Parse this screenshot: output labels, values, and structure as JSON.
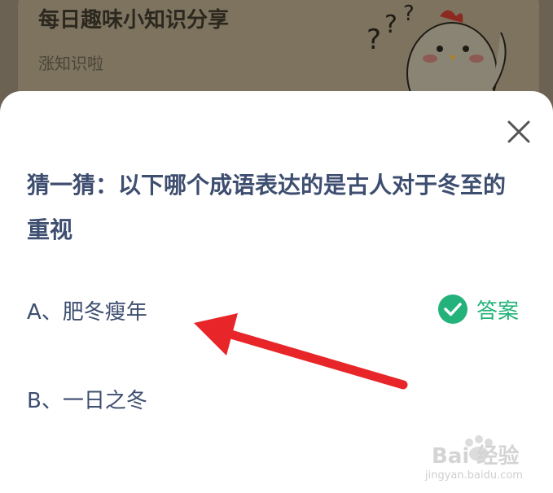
{
  "background_card": {
    "title": "每日趣味小知识分享",
    "subtitle": "涨知识啦"
  },
  "dialog": {
    "question": "猜一猜：以下哪个成语表达的是古人对于冬至的重视",
    "options": [
      {
        "label": "A、肥冬瘦年",
        "is_answer": true
      },
      {
        "label": "B、一日之冬",
        "is_answer": false
      }
    ],
    "answer_label": "答案"
  },
  "watermark": {
    "brand": "Bai 经验",
    "url": "jingyan.baidu.com"
  },
  "colors": {
    "question_text": "#3e4e70",
    "answer_green": "#23b27a",
    "annotation_arrow": "#e8262a"
  },
  "icons": {
    "close": "close-icon",
    "check": "check-circle-icon",
    "arrow": "red-arrow-annotation"
  }
}
